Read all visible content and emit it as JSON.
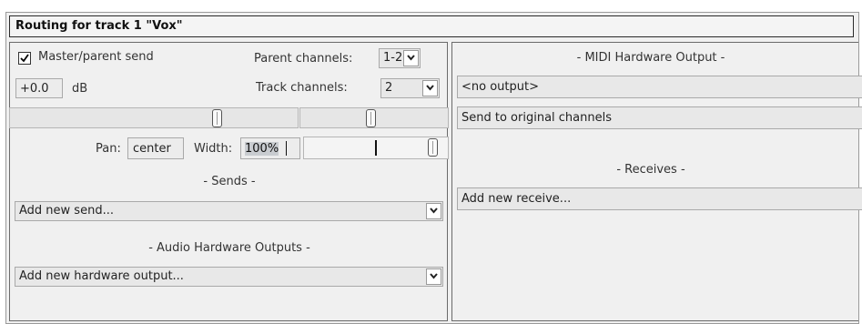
{
  "window": {
    "title": "Routing for track 1 \"Vox\""
  },
  "left": {
    "master_send": {
      "label": "Master/parent send",
      "checked": true
    },
    "parent_channels": {
      "label": "Parent channels:",
      "value": "1-2"
    },
    "track_channels": {
      "label": "Track channels:",
      "value": "2"
    },
    "volume": {
      "value": "+0.0",
      "unit": "dB"
    },
    "pan": {
      "label": "Pan:",
      "value": "center"
    },
    "width": {
      "label": "Width:",
      "value": "100%"
    },
    "sends_header": "- Sends -",
    "add_send": "Add new send...",
    "hw_outputs_header": "- Audio Hardware Outputs -",
    "add_hw_output": "Add new hardware output..."
  },
  "right": {
    "midi_hw_header": "- MIDI Hardware Output -",
    "midi_output": "<no output>",
    "midi_channels": "Send to original channels",
    "receives_header": "- Receives -",
    "add_receive": "Add new receive..."
  },
  "icons": {
    "dropdown": "chevron-down-icon",
    "check": "checkmark-icon",
    "slider_knob": "slider-knob-icon"
  }
}
